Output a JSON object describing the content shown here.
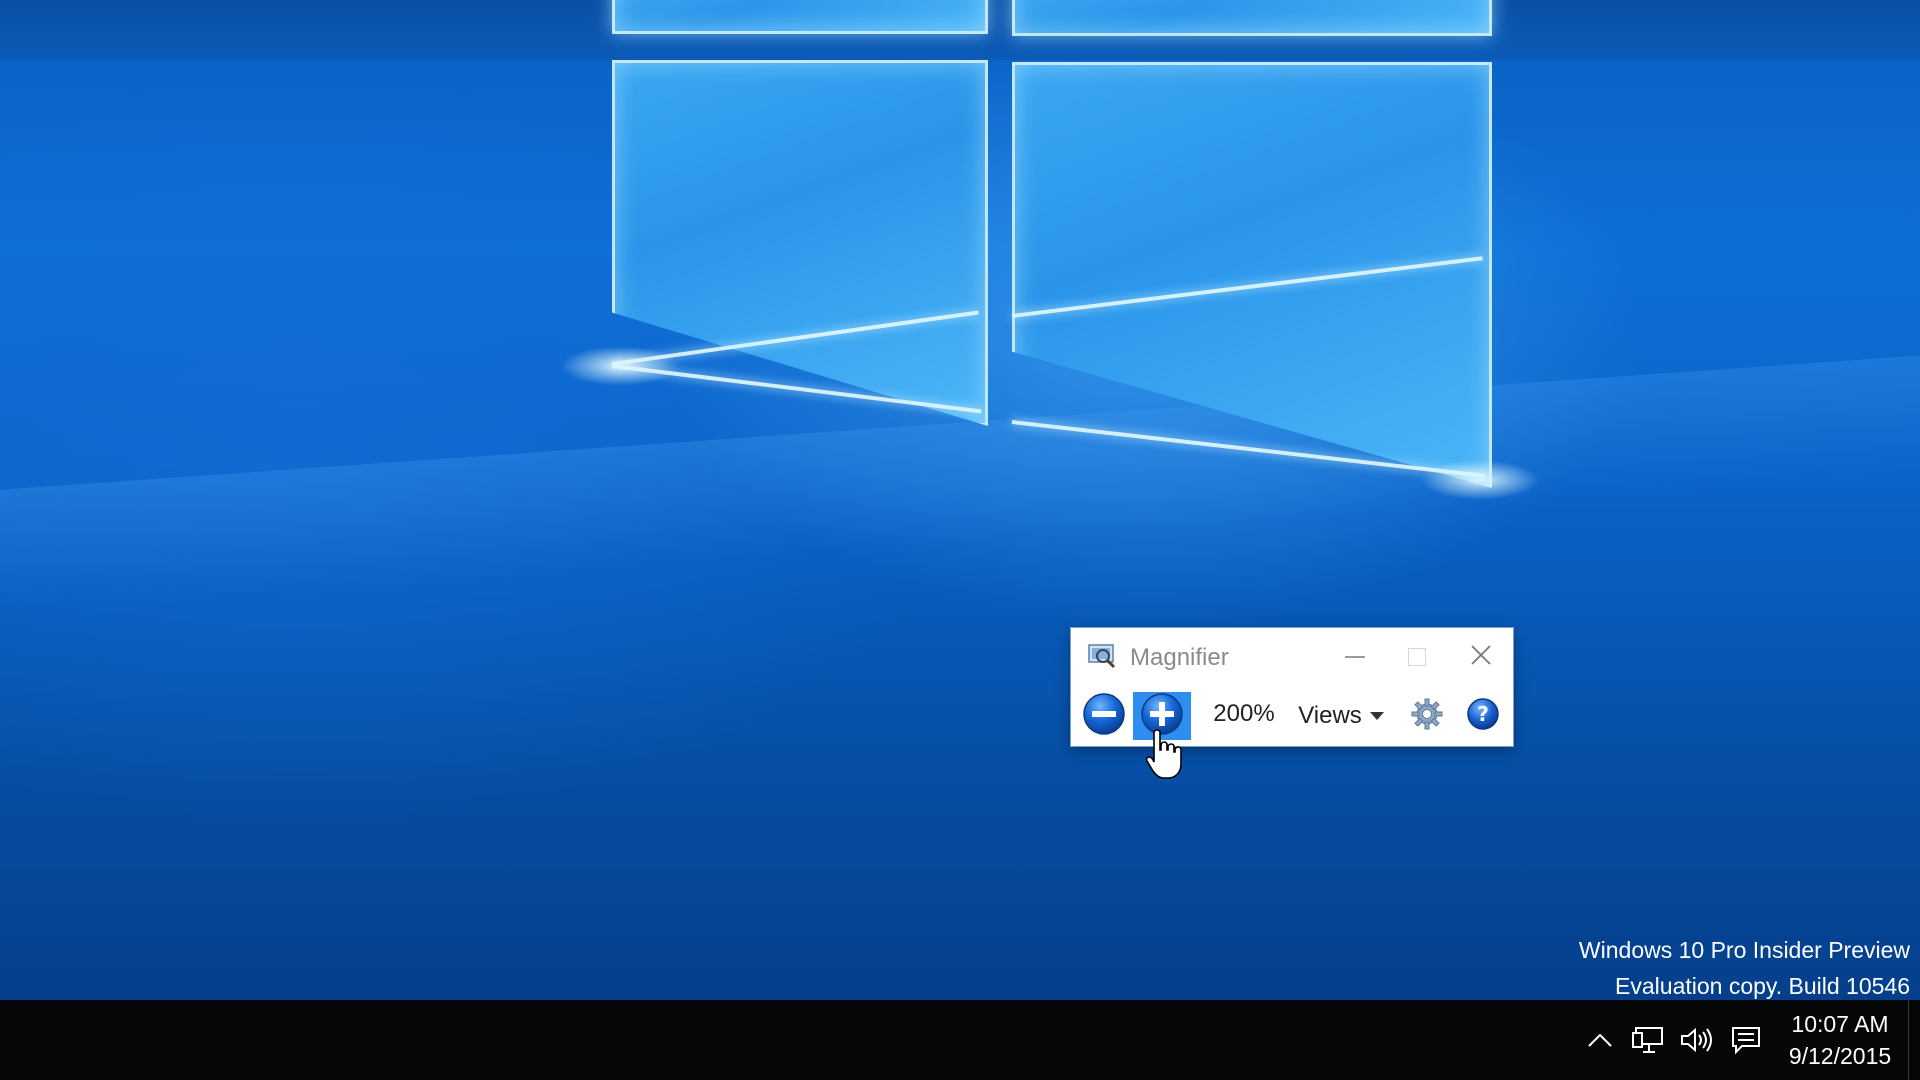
{
  "magnifier": {
    "title": "Magnifier",
    "app_icon": "magnifier-app-icon",
    "minimize_icon": "minimize-icon",
    "maximize_icon": "maximize-icon",
    "close_icon": "close-icon",
    "zoom_out_icon": "zoom-out-icon",
    "zoom_in_icon": "zoom-in-icon",
    "zoom_level": "200%",
    "views_label": "Views",
    "views_icon": "chevron-down-icon",
    "settings_icon": "gear-icon",
    "help_icon": "help-icon",
    "accent_color": "#2d8ef0"
  },
  "desktop": {
    "watermark_line1": "Windows 10 Pro Insider Preview",
    "watermark_line2": "Evaluation copy. Build 10546"
  },
  "taskbar": {
    "tray_icons": [
      "chevron-up-icon",
      "network-icon",
      "volume-icon",
      "action-center-icon"
    ],
    "time": "10:07 AM",
    "date": "9/12/2015"
  },
  "cursor": {
    "type": "hand-pointer-icon"
  }
}
